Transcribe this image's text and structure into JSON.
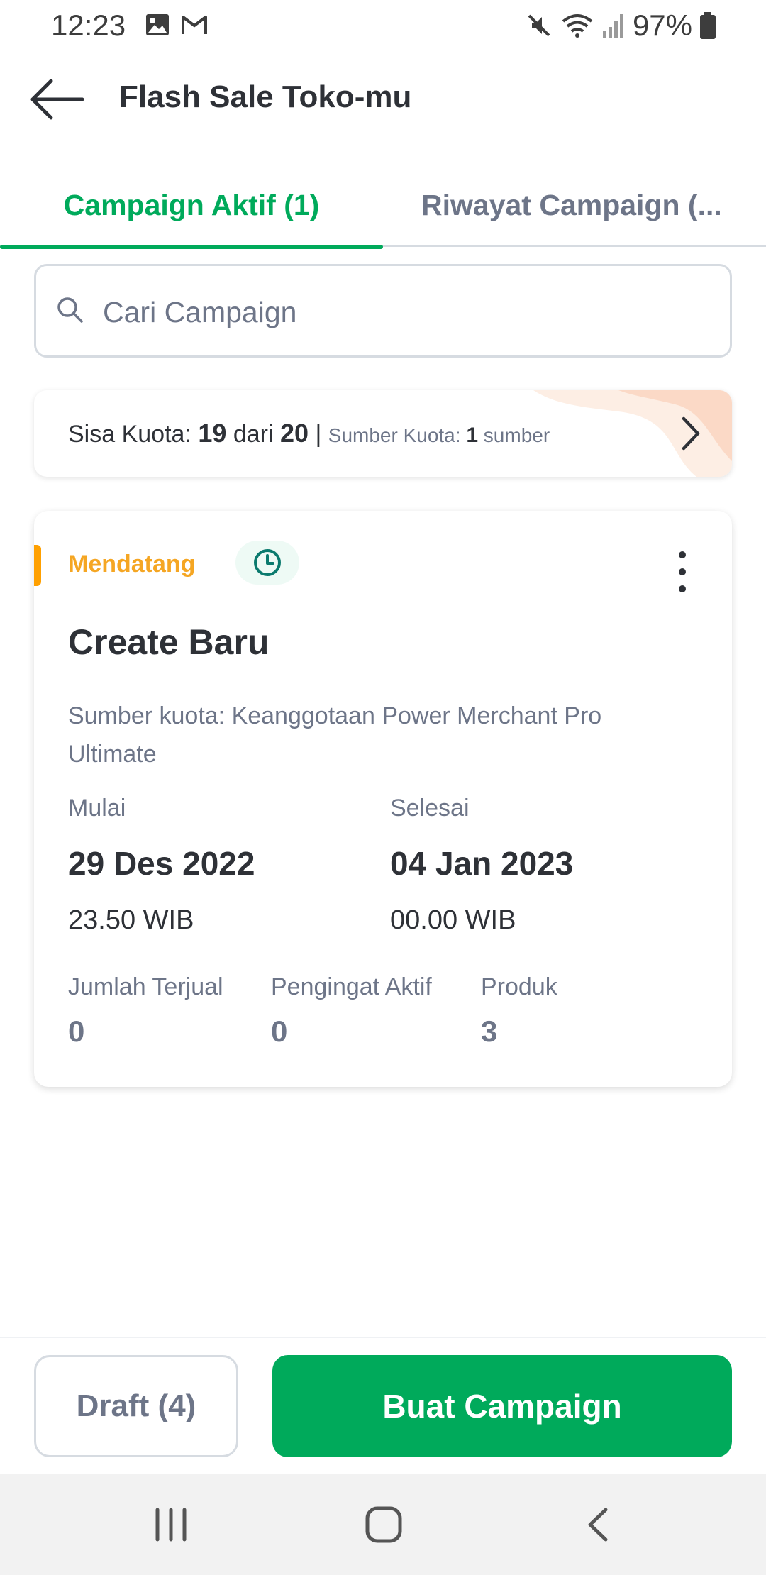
{
  "status_bar": {
    "time": "12:23",
    "battery": "97%",
    "icons": [
      "image-icon",
      "gmail-icon",
      "mute-icon",
      "wifi-icon",
      "signal-icon",
      "battery-icon"
    ]
  },
  "header": {
    "title": "Flash Sale Toko-mu",
    "back_icon": "arrow-left-icon"
  },
  "tabs": [
    {
      "label": "Campaign Aktif (1)",
      "active": true
    },
    {
      "label": "Riwayat Campaign (...",
      "active": false
    }
  ],
  "search": {
    "placeholder": "Cari Campaign",
    "value": ""
  },
  "quota": {
    "label": "Sisa Kuota: ",
    "remaining": "19",
    "of_word": " dari ",
    "total": "20",
    "separator": " | ",
    "source_label": "Sumber Kuota: ",
    "source_count": "1",
    "source_unit": " sumber"
  },
  "campaign": {
    "status": "Mendatang",
    "status_color": "#F5A623",
    "title": "Create Baru",
    "source": "Sumber kuota: Keanggotaan Power Merchant Pro Ultimate",
    "start_label": "Mulai",
    "start_date": "29 Des 2022",
    "start_time": "23.50 WIB",
    "end_label": "Selesai",
    "end_date": "04 Jan 2023",
    "end_time": "00.00 WIB",
    "stats": [
      {
        "label": "Jumlah Terjual",
        "value": "0"
      },
      {
        "label": "Pengingat Aktif",
        "value": "0"
      },
      {
        "label": "Produk",
        "value": "3"
      }
    ]
  },
  "actions": {
    "draft_label": "Draft (4)",
    "create_label": "Buat Campaign",
    "accent": "#00AA5B"
  },
  "nav_bar": {
    "icons": [
      "recents-icon",
      "home-icon",
      "back-icon"
    ]
  }
}
